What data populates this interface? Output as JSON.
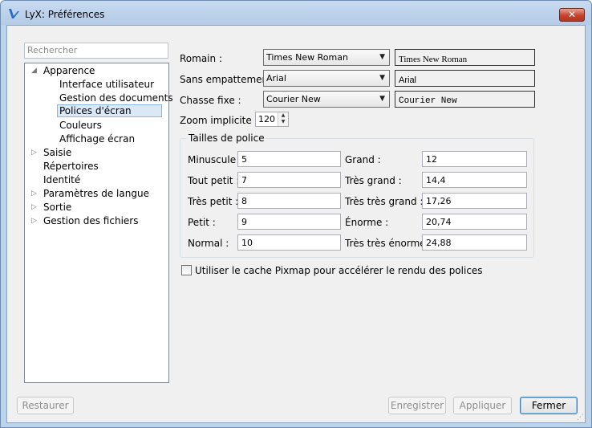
{
  "window": {
    "title": "LyX: Préférences",
    "close_label": "✕"
  },
  "search": {
    "placeholder": "Rechercher"
  },
  "tree": {
    "items": [
      {
        "label": "Apparence",
        "arrow": "◢"
      },
      {
        "label": "Interface utilisateur"
      },
      {
        "label": "Gestion des documents"
      },
      {
        "label": "Polices d'écran",
        "selected": true
      },
      {
        "label": "Couleurs"
      },
      {
        "label": "Affichage écran"
      },
      {
        "label": "Saisie",
        "arrow": "▷"
      },
      {
        "label": "Répertoires"
      },
      {
        "label": "Identité"
      },
      {
        "label": "Paramètres de langue",
        "arrow": "▷"
      },
      {
        "label": "Sortie",
        "arrow": "▷"
      },
      {
        "label": "Gestion des fichiers",
        "arrow": "▷"
      }
    ]
  },
  "fonts": {
    "roman": {
      "label": "Romain :",
      "value": "Times New Roman",
      "preview": "Times New Roman"
    },
    "sans": {
      "label": "Sans empattement :",
      "value": "Arial",
      "preview": "Arial"
    },
    "mono": {
      "label": "Chasse fixe :",
      "value": "Courier New",
      "preview": "Courier New"
    },
    "zoom": {
      "label": "Zoom implicite % :",
      "value": "120"
    }
  },
  "sizes": {
    "title": "Tailles de police",
    "left": [
      {
        "label": "Minuscule :",
        "value": "5"
      },
      {
        "label": "Tout petit :",
        "value": "7"
      },
      {
        "label": "Très petit :",
        "value": "8"
      },
      {
        "label": "Petit :",
        "value": "9"
      },
      {
        "label": "Normal :",
        "value": "10"
      }
    ],
    "right": [
      {
        "label": "Grand :",
        "value": "12"
      },
      {
        "label": "Très grand :",
        "value": "14,4"
      },
      {
        "label": "Très très grand :",
        "value": "17,26"
      },
      {
        "label": "Énorme :",
        "value": "20,74"
      },
      {
        "label": "Très très énorme :",
        "value": "24,88"
      }
    ]
  },
  "pixmap": {
    "label": "Utiliser le cache Pixmap pour accélérer le rendu des polices",
    "checked": false
  },
  "buttons": {
    "restore": "Restaurer",
    "save": "Enregistrer",
    "apply": "Appliquer",
    "close": "Fermer"
  },
  "icons": {
    "combo_arrow": "▼",
    "spin_up": "▲",
    "spin_down": "▼",
    "grip": "⋰"
  }
}
